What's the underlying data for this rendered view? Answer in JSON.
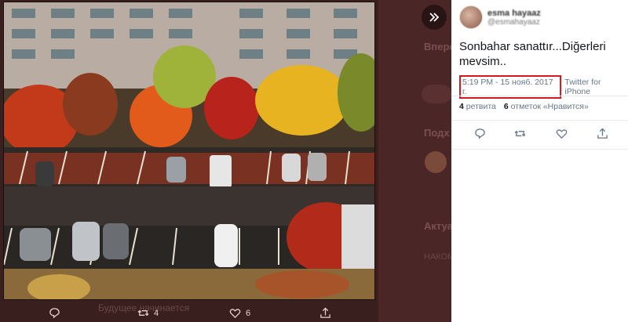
{
  "background": {
    "section1_title": "Впере",
    "section2_title": "Подх",
    "section3_title": "Актуа",
    "section3_item": "НАКОМ",
    "bottom_text": "Будущее начинается"
  },
  "photo": {
    "alt": "Autumn trees over a parking lot"
  },
  "photo_actions": {
    "reply_count": "",
    "retweet_count": "4",
    "like_count": "6"
  },
  "tweet": {
    "author_name": "esma hayaaz",
    "author_handle": "@esmahayaaz",
    "text": "Sonbahar sanattır...Diğerleri mevsim..",
    "timestamp": "5:19 PM - 15 нояб. 2017 г.",
    "via": "Twitter for iPhone",
    "retweets_count": "4",
    "retweets_label": "ретвита",
    "likes_count": "6",
    "likes_label": "отметок «Нравится»"
  },
  "colors": {
    "highlight_box": "#d7181f",
    "meta_text": "#657786"
  }
}
